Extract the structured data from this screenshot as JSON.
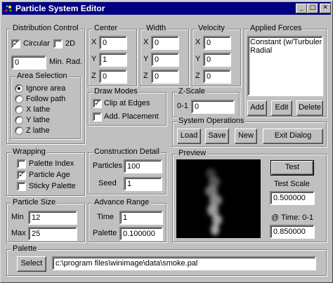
{
  "window": {
    "title": "Particle System Editor",
    "buttons": {
      "minimize": "_",
      "maximize": "□",
      "close": "✕"
    }
  },
  "distribution": {
    "label": "Distribution Control",
    "circular_label": "Circular",
    "circular_checked": true,
    "twod_label": "2D",
    "twod_checked": false,
    "min_rad_value": "0",
    "min_rad_label": "Min. Rad."
  },
  "area": {
    "label": "Area Selection",
    "options": [
      "Ignore area",
      "Follow path",
      "X lathe",
      "Y lathe",
      "Z lathe"
    ],
    "selected": 0
  },
  "center": {
    "label": "Center",
    "x_label": "X",
    "y_label": "Y",
    "z_label": "Z",
    "x": "0",
    "y": "1",
    "z": "0"
  },
  "width": {
    "label": "Width",
    "x_label": "X",
    "y_label": "Y",
    "z_label": "Z",
    "x": "0",
    "y": "0",
    "z": "0"
  },
  "velocity": {
    "label": "Velocity",
    "x_label": "X",
    "y_label": "Y",
    "z_label": "Z",
    "x": "0",
    "y": "0",
    "z": "0"
  },
  "forces": {
    "label": "Applied Forces",
    "items": [
      "Constant (w/Turbulence",
      "Radial"
    ],
    "add": "Add",
    "edit": "Edit",
    "delete": "Delete"
  },
  "draw": {
    "label": "Draw Modes",
    "clip_label": "Clip at Edges",
    "clip_checked": true,
    "add_label": "Add. Placement",
    "add_checked": false
  },
  "zscale": {
    "label": "Z-Scale",
    "range_label": "0-1",
    "value": "0"
  },
  "sysops": {
    "label": "System Operations",
    "load": "Load",
    "save": "Save",
    "new": "New",
    "exit": "Exit Dialog"
  },
  "wrapping": {
    "label": "Wrapping",
    "palette_index": "Palette Index",
    "palette_index_checked": false,
    "particle_age": "Particle Age",
    "particle_age_checked": true,
    "sticky": "Sticky Palette",
    "sticky_checked": false
  },
  "construct": {
    "label": "Construction Detail",
    "particles_label": "Particles",
    "particles": "100",
    "seed_label": "Seed",
    "seed": "1"
  },
  "preview": {
    "label": "Preview",
    "test": "Test",
    "test_scale_label": "Test Scale",
    "test_scale": "0.500000",
    "time_label": "@ Time: 0-1",
    "time": "0.850000"
  },
  "psize": {
    "label": "Particle Size",
    "min_label": "Min",
    "min": "12",
    "max_label": "Max",
    "max": "25"
  },
  "advance": {
    "label": "Advance Range",
    "time_label": "Time",
    "time": "1",
    "palette_label": "Palette",
    "palette": "0.100000"
  },
  "palette": {
    "label": "Palette",
    "select": "Select",
    "path": "c:\\program files\\winimage\\data\\smoke.pal"
  },
  "check_glyph": "✓",
  "icons": {
    "app": "particle-app-icon",
    "smoke": "smoke-plume-preview"
  }
}
